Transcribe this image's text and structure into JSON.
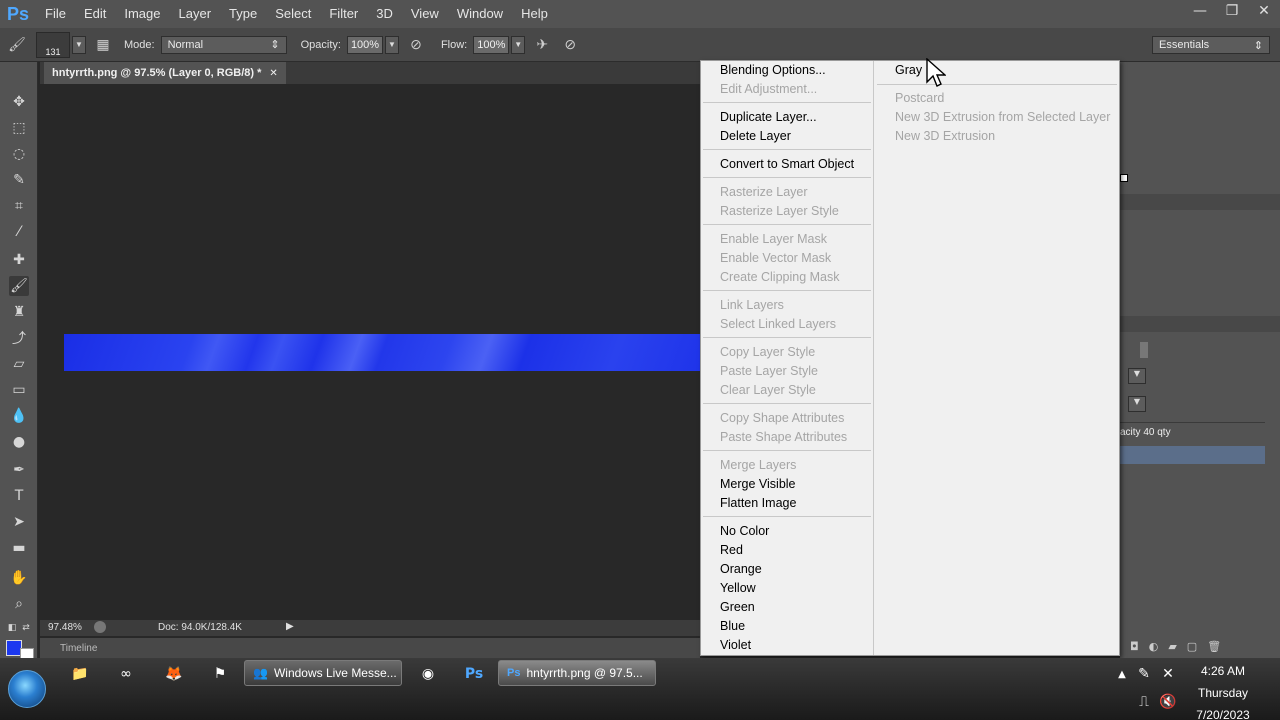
{
  "app": {
    "logo": "Ps",
    "menu": [
      "File",
      "Edit",
      "Image",
      "Layer",
      "Type",
      "Select",
      "Filter",
      "3D",
      "View",
      "Window",
      "Help"
    ],
    "window_controls": {
      "minimize": "—",
      "restore": "❐",
      "close": "✕"
    }
  },
  "options_bar": {
    "brush_size": "131",
    "mode_label": "Mode:",
    "mode_value": "Normal",
    "opacity_label": "Opacity:",
    "opacity_value": "100%",
    "flow_label": "Flow:",
    "flow_value": "100%",
    "workspace": "Essentials"
  },
  "document": {
    "tab_title": "hntyrrth.png @ 97.5% (Layer 0, RGB/8) *",
    "tab_close": "✕",
    "zoom": "97.48%",
    "doc_info": "Doc: 94.0K/128.4K",
    "timeline_label": "Timeline"
  },
  "colors": {
    "foreground": "#1c38f0",
    "background": "#ffffff",
    "strip": "#2a43f0"
  },
  "context_menu": {
    "left": {
      "blending_options": "Blending Options...",
      "edit_adjustment": "Edit Adjustment...",
      "duplicate_layer": "Duplicate Layer...",
      "delete_layer": "Delete Layer",
      "convert_smart": "Convert to Smart Object",
      "rasterize_layer": "Rasterize Layer",
      "rasterize_style": "Rasterize Layer Style",
      "enable_layer_mask": "Enable Layer Mask",
      "enable_vector_mask": "Enable Vector Mask",
      "create_clipping": "Create Clipping Mask",
      "link_layers": "Link Layers",
      "select_linked": "Select Linked Layers",
      "copy_style": "Copy Layer Style",
      "paste_style": "Paste Layer Style",
      "clear_style": "Clear Layer Style",
      "copy_shape": "Copy Shape Attributes",
      "paste_shape": "Paste Shape Attributes",
      "merge_layers": "Merge Layers",
      "merge_visible": "Merge Visible",
      "flatten_image": "Flatten Image",
      "no_color": "No Color",
      "red": "Red",
      "orange": "Orange",
      "yellow": "Yellow",
      "green": "Green",
      "blue": "Blue",
      "violet": "Violet"
    },
    "right": {
      "gray": "Gray",
      "postcard": "Postcard",
      "new_3d_from_selected": "New 3D Extrusion from Selected Layer",
      "new_3d_extrusion": "New 3D Extrusion"
    }
  },
  "layers_panel": {
    "layer_name_partial": "acity 40 qty"
  },
  "taskbar": {
    "messenger_task": "Windows Live Messe...",
    "ps_task": "hntyrrth.png @ 97.5...",
    "time": "4:26 AM",
    "day": "Thursday",
    "date": "7/20/2023"
  }
}
